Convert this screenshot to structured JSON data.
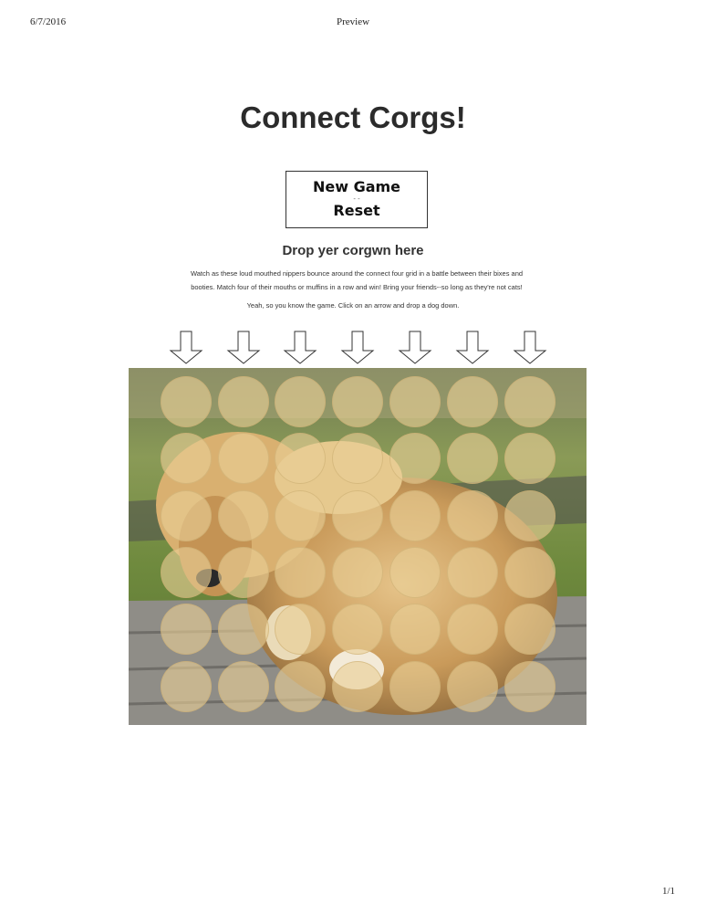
{
  "print_header": {
    "date": "6/7/2016",
    "title": "Preview"
  },
  "page_number": "1/1",
  "title": "Connect Corgs!",
  "controls": {
    "new_game_label": "New Game",
    "separator": "- -",
    "reset_label": "Reset"
  },
  "subtitle": "Drop yer corgwn here",
  "description": "Watch as these loud mouthed nippers bounce around the connect four grid in a battle between their bixes and booties. Match four of their mouths or muffins in a row and win! Bring your friends--so long as they're not cats!",
  "instructions": "Yeah, so you know the game. Click on an arrow and drop a dog down.",
  "board": {
    "columns": 7,
    "rows": 6,
    "background": "puppy-photo",
    "cell_color": "#e8cf96"
  },
  "arrows": {
    "count": 7,
    "icon": "down-arrow-icon"
  }
}
